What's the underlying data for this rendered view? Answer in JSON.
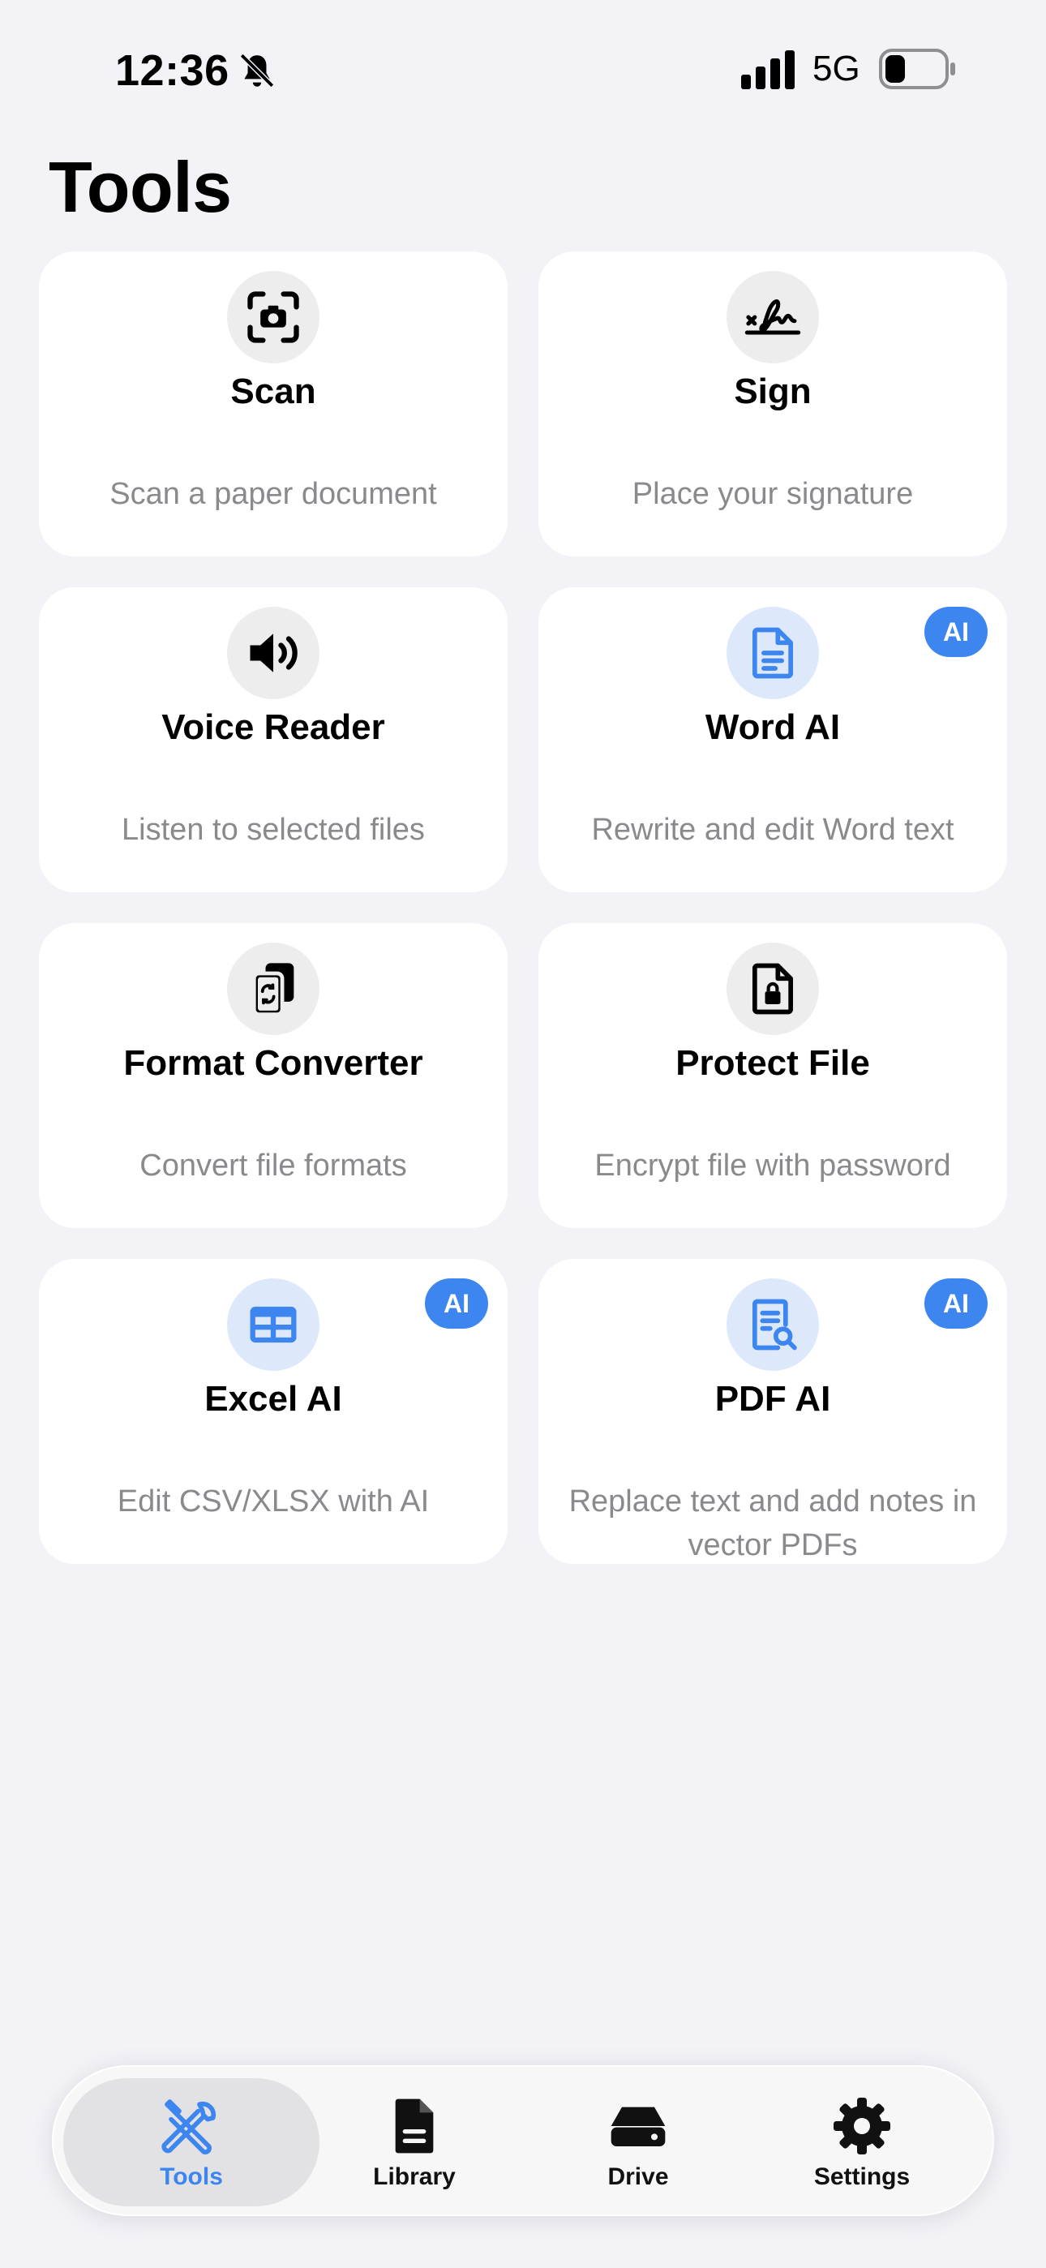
{
  "status_bar": {
    "time": "12:36",
    "network": "5G",
    "icons": [
      "bell-slash-icon",
      "cellular-signal-icon",
      "battery-icon"
    ]
  },
  "page": {
    "title": "Tools"
  },
  "tools": [
    {
      "title": "Scan",
      "description": "Scan a paper document",
      "icon": "camera-scan-icon",
      "ai": false
    },
    {
      "title": "Sign",
      "description": "Place your signature",
      "icon": "signature-icon",
      "ai": false
    },
    {
      "title": "Voice Reader",
      "description": "Listen to selected files",
      "icon": "speaker-icon",
      "ai": false
    },
    {
      "title": "Word AI",
      "description": "Rewrite and edit Word text",
      "icon": "document-icon",
      "ai": true,
      "badge": "AI"
    },
    {
      "title": "Format Converter",
      "description": "Convert file formats",
      "icon": "file-convert-icon",
      "ai": false
    },
    {
      "title": "Protect File",
      "description": "Encrypt file with password",
      "icon": "file-lock-icon",
      "ai": false
    },
    {
      "title": "Excel AI",
      "description": "Edit CSV/XLSX with AI",
      "icon": "table-icon",
      "ai": true,
      "badge": "AI"
    },
    {
      "title": "PDF AI",
      "description": "Replace text and add notes in vector PDFs",
      "icon": "document-search-icon",
      "ai": true,
      "badge": "AI"
    }
  ],
  "tab_bar": {
    "tabs": [
      {
        "label": "Tools",
        "icon": "tools-icon",
        "active": true
      },
      {
        "label": "Library",
        "icon": "file-icon",
        "active": false
      },
      {
        "label": "Drive",
        "icon": "drive-icon",
        "active": false
      },
      {
        "label": "Settings",
        "icon": "gear-icon",
        "active": false
      }
    ]
  },
  "colors": {
    "background": "#f2f2f7",
    "card": "#ffffff",
    "accent": "#3d86f0",
    "secondary_text": "#8a8a8e"
  }
}
